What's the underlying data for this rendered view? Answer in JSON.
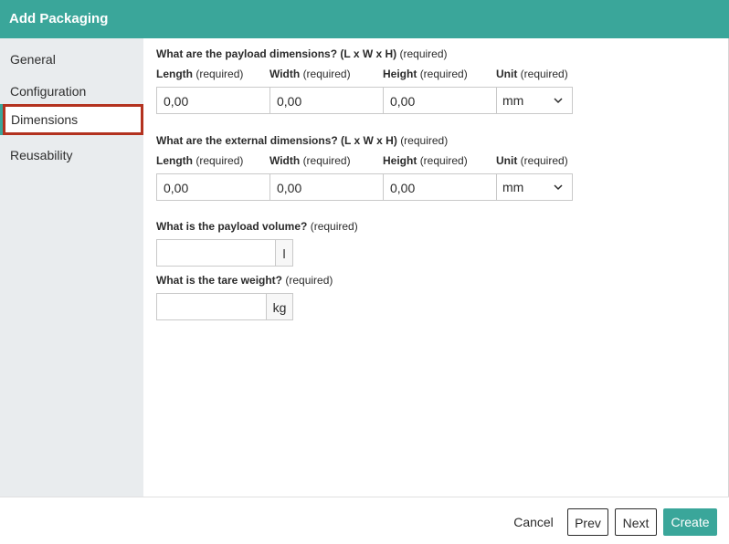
{
  "dialog": {
    "title": "Add Packaging"
  },
  "sidebar": {
    "items": [
      {
        "label": "General"
      },
      {
        "label": "Configuration"
      },
      {
        "label": "Dimensions"
      },
      {
        "label": "Reusability"
      }
    ],
    "active_index": 2
  },
  "payload_dimensions": {
    "question": "What are the payload dimensions? (L x W x H)",
    "required": "(required)",
    "labels": {
      "length": "Length",
      "width": "Width",
      "height": "Height",
      "unit": "Unit"
    },
    "values": {
      "length": "0,00",
      "width": "0,00",
      "height": "0,00",
      "unit": "mm"
    }
  },
  "external_dimensions": {
    "question": "What are the external dimensions? (L x W x H)",
    "required": "(required)",
    "labels": {
      "length": "Length",
      "width": "Width",
      "height": "Height",
      "unit": "Unit"
    },
    "values": {
      "length": "0,00",
      "width": "0,00",
      "height": "0,00",
      "unit": "mm"
    }
  },
  "payload_volume": {
    "question": "What is the payload volume?",
    "required": "(required)",
    "value": "",
    "unit": "l"
  },
  "tare_weight": {
    "question": "What is the tare weight?",
    "required": "(required)",
    "value": "",
    "unit": "kg"
  },
  "req": "(required)",
  "footer": {
    "cancel": "Cancel",
    "prev": "Prev",
    "next": "Next",
    "create": "Create"
  },
  "colors": {
    "accent": "#3aa69a",
    "active_border": "#b3321f",
    "sidebar_bg": "#e9ecee"
  },
  "icons": {
    "unit_dropdown": "chevron-down-icon"
  }
}
